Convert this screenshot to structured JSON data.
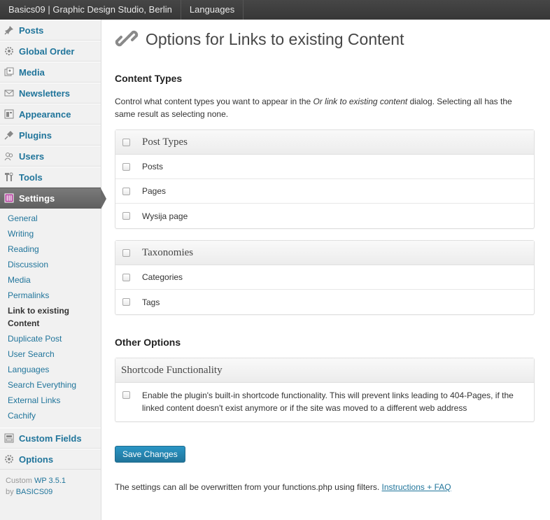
{
  "adminbar": {
    "site_name": "Basics09 | Graphic Design Studio, Berlin",
    "languages": "Languages"
  },
  "sidebar": {
    "items": [
      {
        "label": "Posts",
        "icon": "pin-icon"
      },
      {
        "label": "Global Order",
        "icon": "gear-icon"
      },
      {
        "label": "Media",
        "icon": "media-icon"
      },
      {
        "label": "Newsletters",
        "icon": "envelope-icon"
      },
      {
        "label": "Appearance",
        "icon": "appearance-icon"
      },
      {
        "label": "Plugins",
        "icon": "plug-icon"
      },
      {
        "label": "Users",
        "icon": "users-icon"
      },
      {
        "label": "Tools",
        "icon": "tools-icon"
      },
      {
        "label": "Settings",
        "icon": "settings-icon"
      }
    ],
    "settings_submenu": [
      "General",
      "Writing",
      "Reading",
      "Discussion",
      "Media",
      "Permalinks",
      "Link to existing Content",
      "Duplicate Post",
      "User Search",
      "Languages",
      "Search Everything",
      "External Links",
      "Cachify"
    ],
    "current_submenu_line1": "Link to existing",
    "current_submenu_line2": "Content",
    "after_items": [
      {
        "label": "Custom Fields",
        "icon": "custom-fields-icon"
      },
      {
        "label": "Options",
        "icon": "gear-icon"
      }
    ],
    "footer": {
      "custom": "Custom",
      "wp_version": "WP 3.5.1",
      "by": "by",
      "author": "BASICS09"
    }
  },
  "main": {
    "title": "Options for Links to existing Content",
    "content_types_heading": "Content Types",
    "desc_part1": "Control what content types you want to appear in the ",
    "desc_em": "Or link to existing content",
    "desc_part2": " dialog. Selecting all has the same result as selecting none.",
    "post_types": {
      "title": "Post Types",
      "rows": [
        "Posts",
        "Pages",
        "Wysija page"
      ]
    },
    "taxonomies": {
      "title": "Taxonomies",
      "rows": [
        "Categories",
        "Tags"
      ]
    },
    "other_options_heading": "Other Options",
    "shortcode": {
      "title": "Shortcode Functionality",
      "text": "Enable the plugin's built-in shortcode functionality. This will prevent links leading to 404-Pages, if the linked content doesn't exist anymore or if the site was moved to a different web address"
    },
    "save_button": "Save Changes",
    "footer_note": "The settings can all be overwritten from your functions.php using filters.",
    "footer_link": "Instructions + FAQ"
  },
  "colors": {
    "link": "#21759b",
    "primary_button": "#21759b",
    "admin_bar": "#3c3c3c"
  }
}
